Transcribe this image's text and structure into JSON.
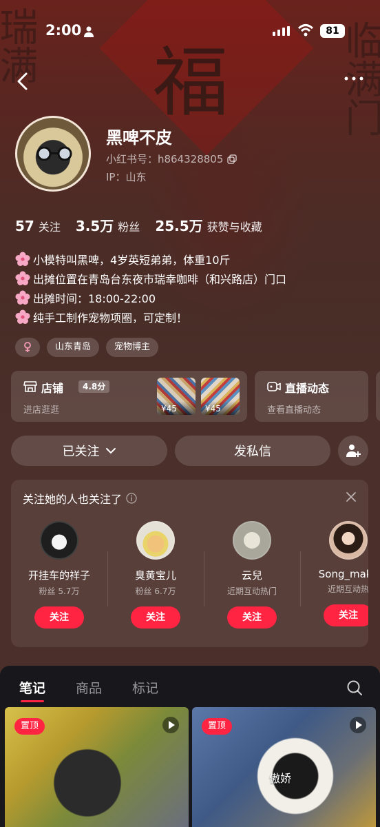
{
  "status_bar": {
    "time": "2:00",
    "battery": "81"
  },
  "profile": {
    "username": "黑啤不皮",
    "redid_label": "小红书号：h864328805",
    "ip_label": "IP：山东"
  },
  "stats": [
    {
      "value": "57",
      "label": "关注"
    },
    {
      "value": "3.5万",
      "label": "粉丝"
    },
    {
      "value": "25.5万",
      "label": "获赞与收藏"
    }
  ],
  "bio": [
    "小模特叫黑啤，4岁英短弟弟，体重10斤",
    "出摊位置在青岛台东夜市瑞幸咖啡（和兴路店）门口",
    "出摊时间：18:00-22:00",
    "纯手工制作宠物项圈，可定制！"
  ],
  "tags": [
    "山东青岛",
    "宠物博主"
  ],
  "store_card": {
    "title": "店铺",
    "rating": "4.8分",
    "subtitle": "进店逛逛",
    "prices": [
      "¥45",
      "¥45"
    ]
  },
  "live_card": {
    "title": "直播动态",
    "subtitle": "查看直播动态"
  },
  "actions": {
    "follow_label": "已关注",
    "message_label": "发私信"
  },
  "recommendations": {
    "title": "关注她的人也关注了",
    "follow_label": "关注",
    "users": [
      {
        "name": "开挂车的祥子",
        "sub": "粉丝 5.7万"
      },
      {
        "name": "臭黄宝儿",
        "sub": "粉丝 6.7万"
      },
      {
        "name": "云兒",
        "sub": "近期互动热门"
      },
      {
        "name": "Song_make",
        "sub": "近期互动热"
      }
    ]
  },
  "tabs": [
    "笔记",
    "商品",
    "标记"
  ],
  "notes": [
    {
      "badge": "置顶",
      "caption": ""
    },
    {
      "badge": "置顶",
      "caption": "傲娇"
    }
  ],
  "colors": {
    "accent": "#ff2442",
    "background": "#4a2f2a",
    "bottom_sheet": "#18181c"
  }
}
